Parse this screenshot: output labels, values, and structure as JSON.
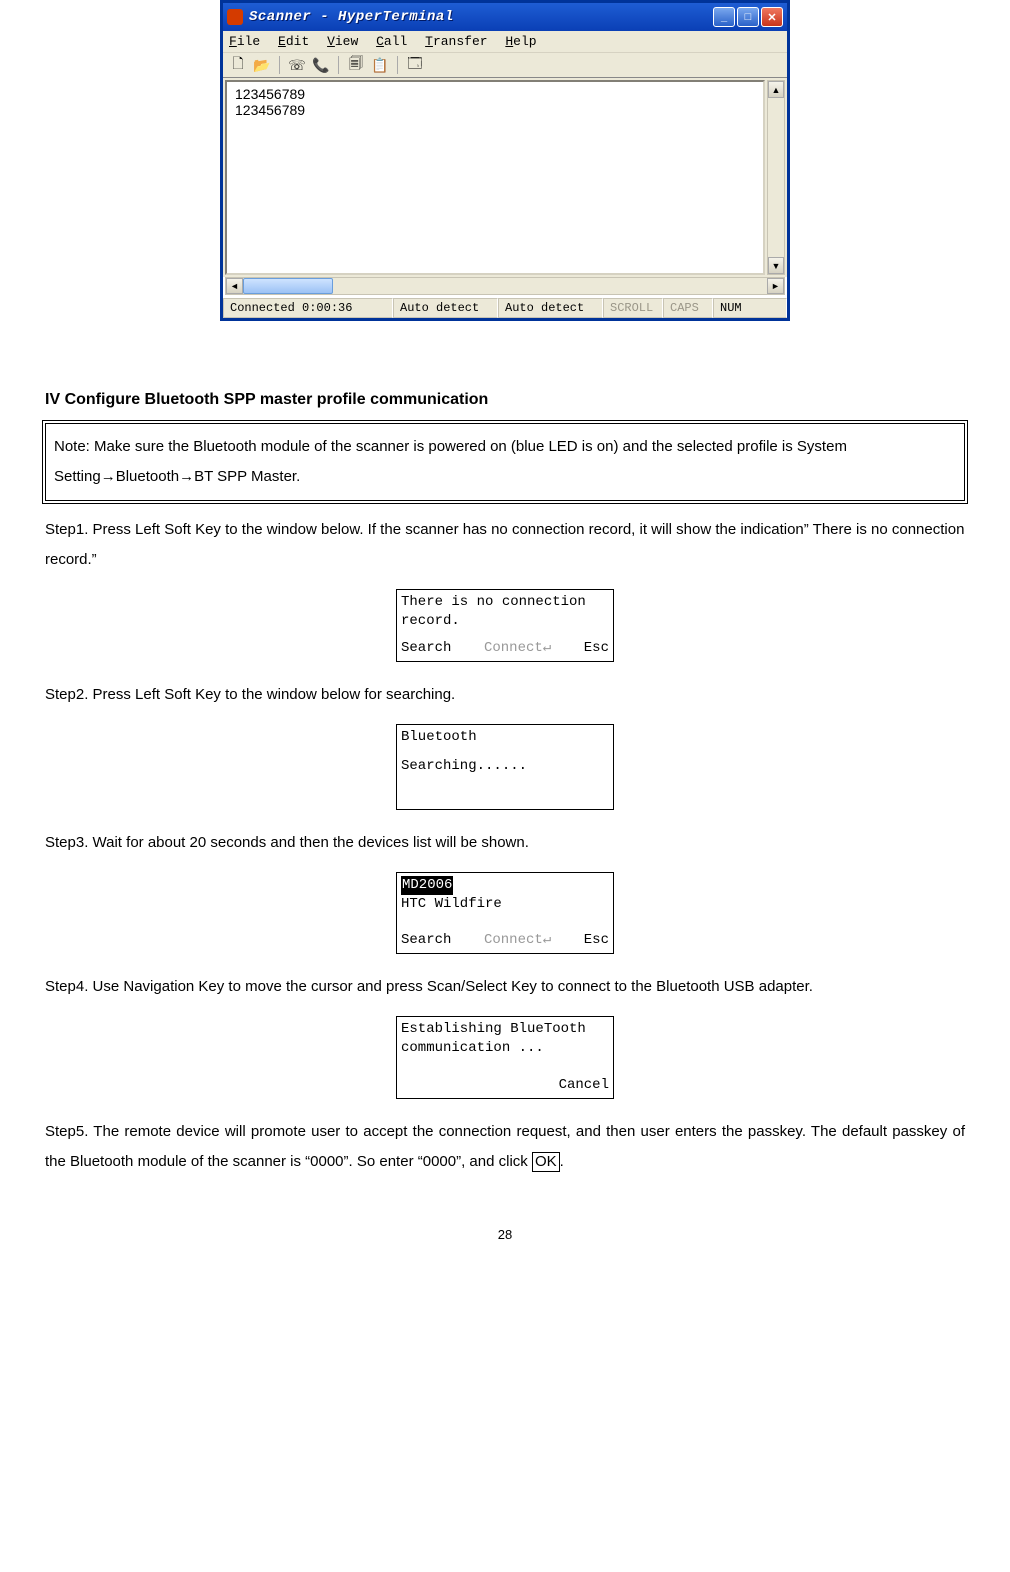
{
  "hyperterminal": {
    "title": "Scanner - HyperTerminal",
    "menus": {
      "file": "File",
      "edit": "Edit",
      "view": "View",
      "call": "Call",
      "transfer": "Transfer",
      "help": "Help"
    },
    "content_line1": "123456789",
    "content_line2": "123456789",
    "status": {
      "connected": "Connected 0:00:36",
      "detect1": "Auto detect",
      "detect2": "Auto detect",
      "scroll": "SCROLL",
      "caps": "CAPS",
      "num": "NUM"
    }
  },
  "section_heading": "IV  Configure Bluetooth SPP master profile communication",
  "note": "Note: Make sure the Bluetooth module of the scanner is powered on (blue LED is on) and the selected profile is System Setting→Bluetooth→BT SPP Master.",
  "step1": "Step1. Press Left Soft Key to the window below. If the scanner has no connection record, it will show the indication” There is no connection record.”",
  "step2": "Step2. Press Left Soft Key to the window below for searching.",
  "step3": "Step3. Wait for about 20 seconds and then the devices list will be shown.",
  "step4": "Step4. Use Navigation Key to move the cursor and press Scan/Select Key to connect to the Bluetooth USB adapter.",
  "step5_a": "Step5. The remote device will promote user to accept the connection request, and then user enters the passkey. The default passkey of the Bluetooth module of the scanner is “0000”. So enter “0000”, and click ",
  "step5_ok": "OK",
  "step5_b": ".",
  "lcd1": {
    "l1": "There is  no connection",
    "l2": "record.",
    "soft_left": "Search",
    "soft_mid": "Connect↵",
    "soft_right": "Esc"
  },
  "lcd2": {
    "l1": "Bluetooth",
    "l2": "Searching......"
  },
  "lcd3": {
    "sel": "MD2006",
    "l2": "HTC Wildfire",
    "soft_left": "Search",
    "soft_mid": "Connect↵",
    "soft_right": "Esc"
  },
  "lcd4": {
    "l1": "Establishing  BlueTooth",
    "l2": "communication ...",
    "cancel": "Cancel"
  },
  "page_number": "28"
}
